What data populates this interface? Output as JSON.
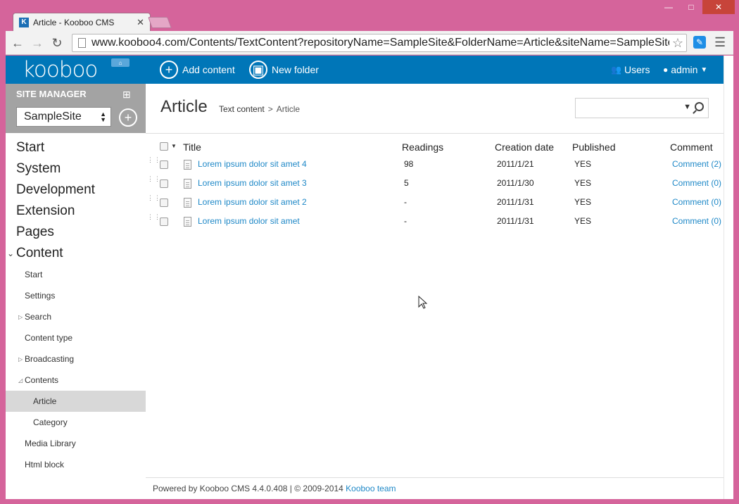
{
  "browser": {
    "tab_title": "Article - Kooboo CMS",
    "tab_favicon": "K",
    "url": "www.kooboo4.com/Contents/TextContent?repositoryName=SampleSite&FolderName=Article&siteName=SampleSite",
    "controls": {
      "minimize": "—",
      "maximize": "□",
      "close": "✕"
    }
  },
  "topbar": {
    "logo": "kooboo",
    "add_content": "Add content",
    "new_folder": "New folder",
    "users": "Users",
    "admin": "admin"
  },
  "sidebar": {
    "site_manager": "SITE MANAGER",
    "site_selected": "SampleSite",
    "main_items": [
      "Start",
      "System",
      "Development",
      "Extension",
      "Pages",
      "Content"
    ],
    "content_items": {
      "start": "Start",
      "settings": "Settings",
      "search": "Search",
      "content_type": "Content type",
      "broadcasting": "Broadcasting",
      "contents": "Contents",
      "article": "Article",
      "category": "Category",
      "media_library": "Media Library",
      "html_block": "Html block"
    }
  },
  "page": {
    "title": "Article",
    "breadcrumb_root": "Text content",
    "breadcrumb_sep": ">",
    "breadcrumb_current": "Article"
  },
  "grid": {
    "headers": {
      "title": "Title",
      "readings": "Readings",
      "creation_date": "Creation date",
      "published": "Published",
      "comment": "Comment"
    },
    "rows": [
      {
        "title": "Lorem ipsum dolor sit amet 4",
        "readings": "98",
        "date": "2011/1/21",
        "published": "YES",
        "comment": "Comment (2)"
      },
      {
        "title": "Lorem ipsum dolor sit amet 3",
        "readings": "5",
        "date": "2011/1/30",
        "published": "YES",
        "comment": "Comment (0)"
      },
      {
        "title": "Lorem ipsum dolor sit amet 2",
        "readings": "-",
        "date": "2011/1/31",
        "published": "YES",
        "comment": "Comment (0)"
      },
      {
        "title": "Lorem ipsum dolor sit amet",
        "readings": "-",
        "date": "2011/1/31",
        "published": "YES",
        "comment": "Comment (0)"
      }
    ]
  },
  "footer": {
    "text": "Powered by Kooboo CMS 4.4.0.408 | © 2009-2014 ",
    "link": "Kooboo team"
  },
  "colors": {
    "brand": "#0076b8",
    "link": "#1e88c7",
    "window_frame": "#d5649b"
  }
}
